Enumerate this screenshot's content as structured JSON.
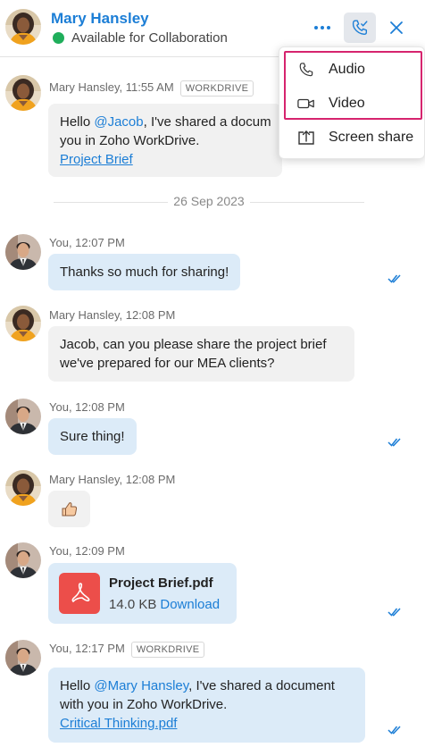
{
  "header": {
    "contact_name": "Mary Hansley",
    "status_text": "Available for Collaboration",
    "status_color": "#1fae5b",
    "icons": {
      "more": "more-dots-icon",
      "call": "phone-call-icon",
      "close": "close-icon"
    }
  },
  "call_menu": {
    "items": [
      {
        "label": "Audio",
        "icon": "phone-icon"
      },
      {
        "label": "Video",
        "icon": "video-camera-icon"
      },
      {
        "label": "Screen share",
        "icon": "screen-share-icon"
      }
    ],
    "highlight_color": "#d6246e"
  },
  "messages": [
    {
      "sender": "Mary Hansley",
      "time": "11:55 AM",
      "meta": "Mary Hansley, 11:55 AM",
      "tag": "WORKDRIVE",
      "parts": {
        "pre": "Hello ",
        "mention": "@Jacob",
        "post1": ", I've shared a docum",
        "post2": "you in Zoho WorkDrive.",
        "link": "Project Brief"
      }
    },
    {
      "sender": "You",
      "meta": "You, 12:07 PM",
      "text": "Thanks so much for sharing!"
    },
    {
      "sender": "Mary Hansley",
      "meta": "Mary Hansley, 12:08 PM",
      "line1": "Jacob, can you please share the project brief",
      "line2": "we've prepared for our MEA clients?"
    },
    {
      "sender": "You",
      "meta": "You, 12:08 PM",
      "text": "Sure thing!"
    },
    {
      "sender": "Mary Hansley",
      "meta": "Mary Hansley, 12:08 PM",
      "reaction": "thumbs-up-icon"
    },
    {
      "sender": "You",
      "meta": "You, 12:09 PM",
      "file_name": "Project Brief.pdf",
      "file_size": "14.0 KB",
      "download_label": "Download"
    },
    {
      "sender": "You",
      "meta": "You, 12:17 PM",
      "tag": "WORKDRIVE",
      "parts": {
        "pre": "Hello ",
        "mention": "@Mary Hansley",
        "post1": ", I've shared a document",
        "post2": "with you in Zoho WorkDrive.",
        "link": "Critical Thinking.pdf"
      }
    }
  ],
  "date_separator": "26 Sep 2023",
  "colors": {
    "accent": "#1c7ed6",
    "incoming_bubble": "#f1f1f1",
    "outgoing_bubble": "#dcebf8",
    "pdf_red": "#ec4e4a"
  }
}
